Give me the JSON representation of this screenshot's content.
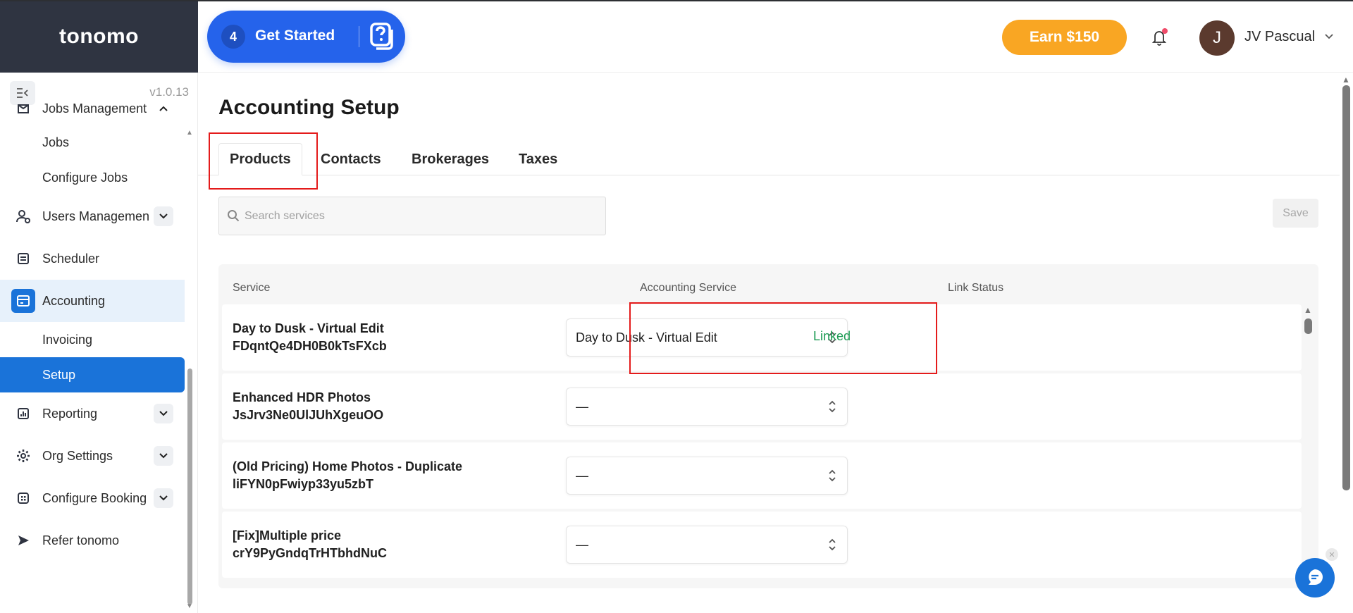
{
  "brand": {
    "logo": "tonomo"
  },
  "sidebar": {
    "version": "v1.0.13",
    "items": [
      {
        "label": "Jobs Management",
        "icon": "jobs-icon",
        "expanded": true
      },
      {
        "label": "Jobs"
      },
      {
        "label": "Configure Jobs"
      },
      {
        "label": "Users Managemen",
        "icon": "users-icon"
      },
      {
        "label": "Scheduler",
        "icon": "scheduler-icon"
      },
      {
        "label": "Accounting",
        "icon": "accounting-icon",
        "active": true
      },
      {
        "label": "Invoicing"
      },
      {
        "label": "Setup",
        "active": true
      },
      {
        "label": "Reporting",
        "icon": "reporting-icon"
      },
      {
        "label": "Org Settings",
        "icon": "gear-icon"
      },
      {
        "label": "Configure Booking",
        "icon": "booking-icon"
      },
      {
        "label": "Refer tonomo",
        "icon": "send-icon"
      }
    ]
  },
  "header": {
    "get_started": {
      "count": "4",
      "label": "Get Started"
    },
    "earn_label": "Earn $150",
    "user": {
      "initial": "J",
      "name": "JV Pascual"
    }
  },
  "main": {
    "title": "Accounting Setup",
    "tabs": [
      {
        "label": "Products",
        "active": true
      },
      {
        "label": "Contacts"
      },
      {
        "label": "Brokerages"
      },
      {
        "label": "Taxes"
      }
    ],
    "search": {
      "placeholder": "Search services",
      "value": ""
    },
    "save_label": "Save",
    "table": {
      "headers": [
        "Service",
        "Accounting Service",
        "Link Status"
      ],
      "rows": [
        {
          "service": "Day to Dusk - Virtual Edit",
          "id": "FDqntQe4DH0B0kTsFXcb",
          "accounting_service": "Day to Dusk - Virtual Edit",
          "status": "Linked"
        },
        {
          "service": "Enhanced HDR Photos",
          "id": "JsJrv3Ne0UlJUhXgeuOO",
          "accounting_service": "—",
          "status": ""
        },
        {
          "service": "(Old Pricing) Home Photos - Duplicate",
          "id": "liFYN0pFwiyp33yu5zbT",
          "accounting_service": "—",
          "status": ""
        },
        {
          "service": "[Fix]Multiple price",
          "id": "crY9PyGndqTrHTbhdNuC",
          "accounting_service": "—",
          "status": ""
        }
      ]
    }
  },
  "colors": {
    "brand_dark": "#2f3441",
    "primary": "#2563eb",
    "accent_orange": "#f9a623",
    "linked_green": "#1a9a52",
    "highlight_red": "#e41b1b"
  }
}
